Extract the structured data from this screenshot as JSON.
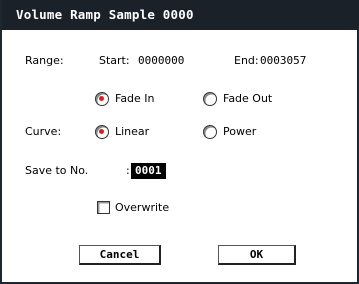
{
  "dialog": {
    "title": "Volume Ramp Sample 0000",
    "range": {
      "label": "Range:",
      "start_label": "Start:",
      "start_value": "0000000",
      "end_label": "End:",
      "end_value": "0003057"
    },
    "fade": {
      "fade_in_label": "Fade In",
      "fade_in_selected": true,
      "fade_out_label": "Fade Out",
      "fade_out_selected": false
    },
    "curve": {
      "label": "Curve:",
      "linear_label": "Linear",
      "linear_selected": true,
      "power_label": "Power",
      "power_selected": false
    },
    "save_to": {
      "label": "Save to No.",
      "colon": ":",
      "value": "0001"
    },
    "overwrite": {
      "label": "Overwrite",
      "checked": false
    },
    "buttons": {
      "cancel": "Cancel",
      "ok": "OK"
    },
    "colors": {
      "titlebar": "#1a2128",
      "radio_dot": "#d81e1e"
    }
  }
}
